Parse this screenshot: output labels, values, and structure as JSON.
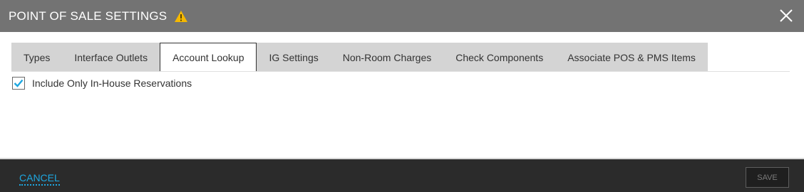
{
  "dialog": {
    "title": "POINT OF SALE SETTINGS",
    "warning_icon": "warning-icon",
    "close_icon": "close-icon"
  },
  "tabs": [
    {
      "label": "Types",
      "active": false
    },
    {
      "label": "Interface Outlets",
      "active": false
    },
    {
      "label": "Account Lookup",
      "active": true
    },
    {
      "label": "IG Settings",
      "active": false
    },
    {
      "label": "Non-Room Charges",
      "active": false
    },
    {
      "label": "Check Components",
      "active": false
    },
    {
      "label": "Associate POS & PMS Items",
      "active": false
    }
  ],
  "account_lookup": {
    "include_in_house_label": "Include Only In-House Reservations",
    "include_in_house_checked": true
  },
  "footer": {
    "cancel_label": "CANCEL",
    "save_label": "SAVE"
  },
  "colors": {
    "header_bg": "#737373",
    "footer_bg": "#2b2b2b",
    "accent": "#1ea7e0",
    "warning": "#f5b800"
  }
}
